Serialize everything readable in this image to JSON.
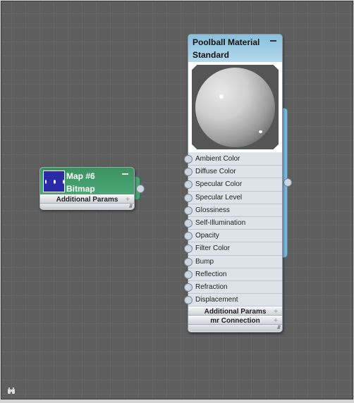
{
  "colors": {
    "canvas": "#5e5e5e",
    "map_header": "#3f9a68",
    "material_header": "#9ccbe4",
    "output_bar": "#7ab9dc",
    "bitmap_thumb": "#2a2aa8"
  },
  "map_node": {
    "title": "Map #6",
    "subtitle": "Bitmap",
    "rollouts": [
      "Additional Params"
    ]
  },
  "material_node": {
    "title": "Poolball Material",
    "subtitle": "Standard",
    "slots": [
      "Ambient Color",
      "Diffuse Color",
      "Specular Color",
      "Specular Level",
      "Glossiness",
      "Self-Illumination",
      "Opacity",
      "Filter Color",
      "Bump",
      "Reflection",
      "Refraction",
      "Displacement"
    ],
    "rollouts": [
      "Additional Params",
      "mr Connection"
    ]
  },
  "corner_icon": "binoculars-icon"
}
